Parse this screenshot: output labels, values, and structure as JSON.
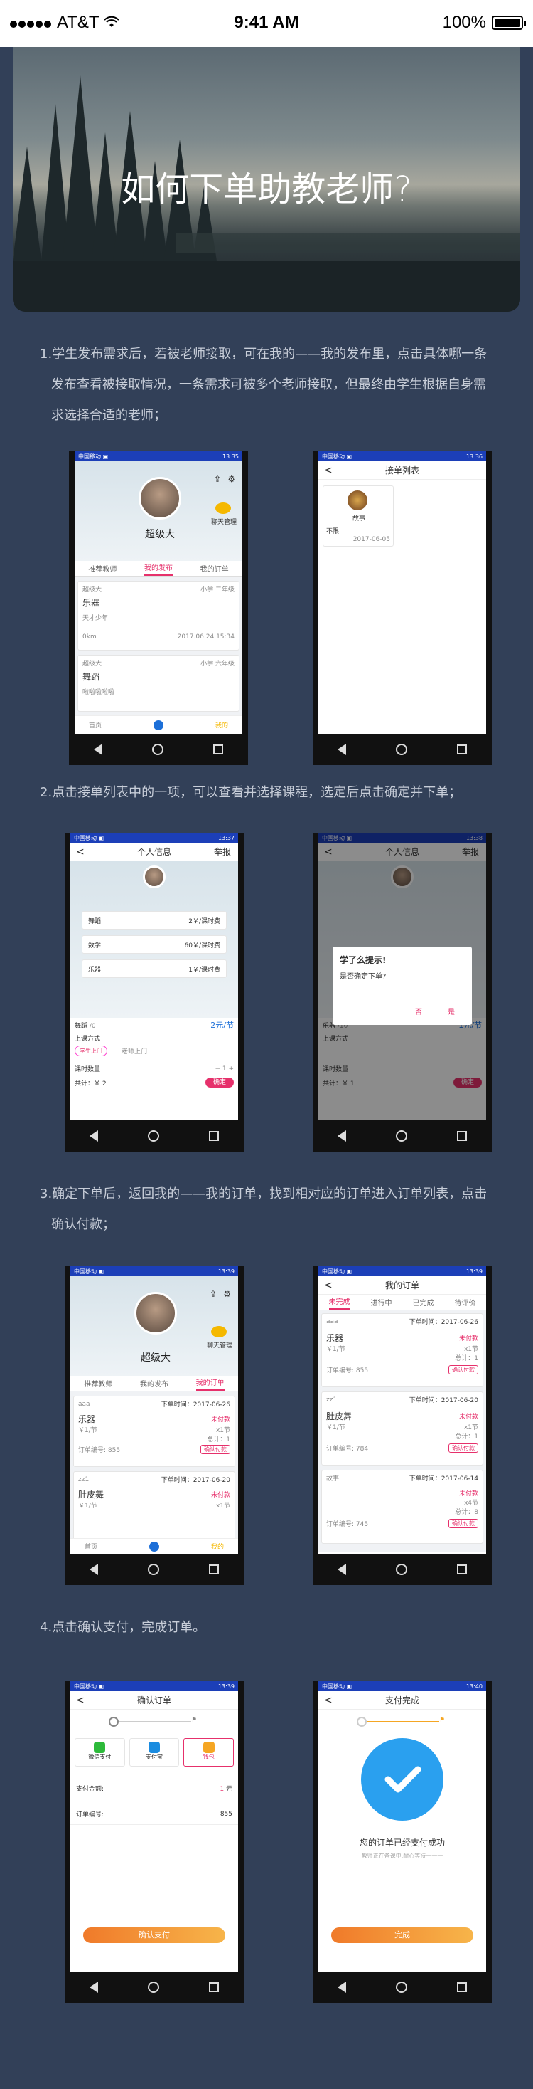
{
  "status": {
    "carrier": "AT&T",
    "time": "9:41 AM",
    "battery": "100%"
  },
  "hero": {
    "title": "如何下单助教老师?"
  },
  "steps": [
    {
      "lines": [
        "1.学生发布需求后，若被老师接取，可在我的——我的发布里，点击具体哪一条",
        "发布查看被接取情况，一条需求可被多个老师接取，但最终由学生根据自身需",
        "求选择合适的老师；"
      ]
    },
    {
      "lines": [
        "2.点击接单列表中的一项，可以查看并选择课程，选定后点击确定并下单；"
      ]
    },
    {
      "lines": [
        "3.确定下单后，返回我的——我的订单，找到相对应的订单进入订单列表，点击",
        "确认付款；"
      ]
    },
    {
      "lines": [
        "4.点击确认支付，完成订单。"
      ]
    }
  ],
  "phones": {
    "p1": {
      "sbar_l": "中国移动 ▣",
      "sbar_r": "13:35",
      "username": "超级大",
      "chat": "聊天管理",
      "tabs": [
        "推荐教师",
        "我的发布",
        "我的订单"
      ],
      "items": [
        {
          "user": "超级大",
          "tag": "小学 二年级",
          "tag2": "0/8",
          "title": "乐器",
          "desc": "天才少年",
          "dist": "0km",
          "date": "2017.06.24 15:34"
        },
        {
          "user": "超级大",
          "tag": "小学 六年级",
          "tag2": "0/8",
          "title": "舞蹈",
          "desc": "啦啦啦啦啦",
          "dist": "",
          "date": ""
        }
      ],
      "bottom": [
        "首页",
        "",
        "我的"
      ]
    },
    "p2": {
      "sbar_l": "中国移动 ▣",
      "sbar_r": "13:36",
      "header": "接单列表",
      "name": "故事",
      "note": "不限",
      "date": "2017-06-05"
    },
    "p3": {
      "sbar_l": "中国移动 ▣",
      "sbar_r": "13:37",
      "header": "个人信息",
      "right": "举报",
      "courses": [
        {
          "name": "舞蹈",
          "price": "2￥/课时费"
        },
        {
          "name": "数学",
          "price": "60￥/课时费"
        },
        {
          "name": "乐器",
          "price": "1￥/课时费"
        }
      ],
      "sel_name": "舞蹈",
      "sel_unit": "/0",
      "sel_price": "2元/节",
      "method": "上课方式",
      "m1": "学生上门",
      "m2": "老师上门",
      "hours": "课时数量",
      "count": "1",
      "total": "共计：￥ 2",
      "confirm": "确定"
    },
    "p4": {
      "sbar_l": "中国移动 ▣",
      "sbar_r": "13:38",
      "header": "个人信息",
      "right": "举报",
      "dlg_title": "学了么提示!",
      "dlg_msg": "是否确定下单?",
      "no": "否",
      "yes": "是",
      "sel_name": "乐器",
      "sel_unit": "/10",
      "sel_price": "1元/节",
      "method": "上课方式",
      "hours": "课时数量",
      "total": "共计：￥ 1",
      "confirm": "确定"
    },
    "p5": {
      "sbar_l": "中国移动 ▣",
      "sbar_r": "13:39",
      "username": "超级大",
      "chat": "聊天管理",
      "tabs": [
        "推荐教师",
        "我的发布",
        "我的订单"
      ],
      "orders": [
        {
          "user": "aaa",
          "time": "下单时间：2017-06-26",
          "title": "乐器",
          "price": "￥1/节",
          "status": "未付款",
          "qty": "x1节",
          "total": "总计：1",
          "no": "订单编号: 855",
          "btn": "确认付款"
        },
        {
          "user": "zz1",
          "time": "下单时间：2017-06-20",
          "title": "肚皮舞",
          "price": "￥1/节",
          "status": "未付款",
          "qty": "x1节",
          "total": "",
          "no": "",
          "btn": ""
        }
      ],
      "bottom": [
        "首页",
        "",
        "我的"
      ]
    },
    "p6": {
      "sbar_l": "中国移动 ▣",
      "sbar_r": "13:39",
      "header": "我的订单",
      "tabs": [
        "未完成",
        "进行中",
        "已完成",
        "待评价"
      ],
      "orders": [
        {
          "user": "aaa",
          "time": "下单时间：2017-06-26",
          "title": "乐器",
          "price": "￥1/节",
          "status": "未付款",
          "qty": "x1节",
          "total": "总计：1",
          "no": "订单编号: 855",
          "btn": "确认付款"
        },
        {
          "user": "zz1",
          "time": "下单时间：2017-06-20",
          "title": "肚皮舞",
          "price": "￥1/节",
          "status": "未付款",
          "qty": "x1节",
          "total": "总计：1",
          "no": "订单编号: 784",
          "btn": "确认付款"
        },
        {
          "user": "故事",
          "time": "下单时间：2017-06-14",
          "title": "",
          "price": "",
          "status": "未付款",
          "qty": "x4节",
          "total": "总计：8",
          "no": "订单编号: 745",
          "btn": "确认付款"
        }
      ]
    },
    "p7": {
      "sbar_l": "中国移动 ▣",
      "sbar_r": "13:39",
      "header": "确认订单",
      "pay": [
        "微信支付",
        "支付宝",
        "钱包"
      ],
      "amount_label": "支付金额:",
      "amount": "1",
      "unit": "元",
      "order_label": "订单编号:",
      "order_no": "855",
      "confirm": "确认支付"
    },
    "p8": {
      "sbar_l": "中国移动 ▣",
      "sbar_r": "13:40",
      "header": "支付完成",
      "msg": "您的订单已经支付成功",
      "sub": "教师正在备课中,耐心等待一一一",
      "done": "完成"
    }
  },
  "colors": {
    "bg": "#324058",
    "accent": "#e6306b",
    "blue": "#1c3fb8"
  }
}
